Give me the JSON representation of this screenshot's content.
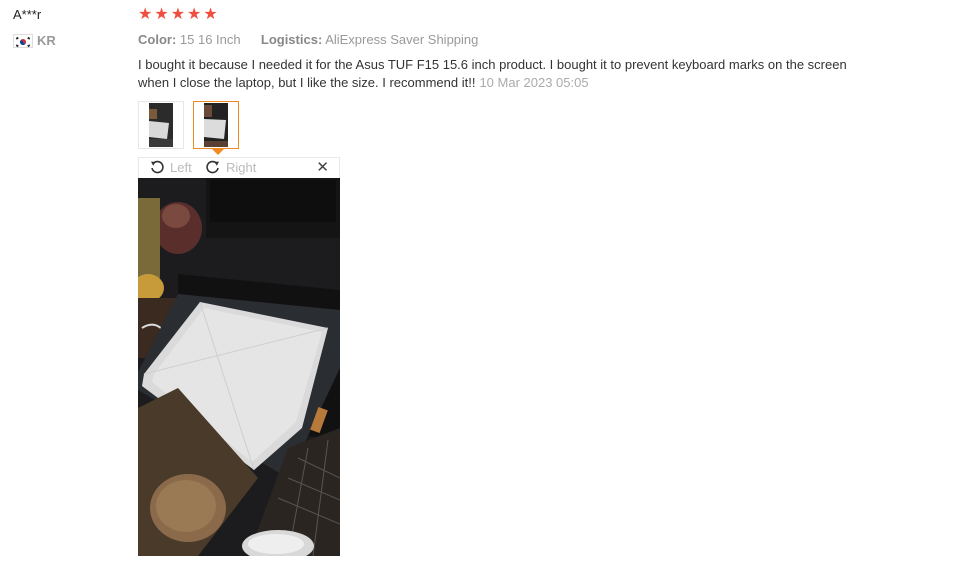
{
  "reviewer": {
    "name": "A***r",
    "country_code": "KR",
    "flag_icon": "korea-flag-icon"
  },
  "rating": {
    "value": 5,
    "max": 5,
    "star_color": "#f04e3e"
  },
  "meta": {
    "color_label": "Color:",
    "color_value": "15 16 Inch",
    "logistics_label": "Logistics:",
    "logistics_value": "AliExpress Saver Shipping"
  },
  "review": {
    "text": "I bought it because I needed it for the Asus TUF F15 15.6 inch product. I bought it to prevent keyboard marks on the screen when I close the laptop, but I like the size. I recommend it!!",
    "date": "10 Mar 2023 05:05"
  },
  "thumbnails": [
    {
      "name": "photo-1",
      "active": false
    },
    {
      "name": "photo-2",
      "active": true
    }
  ],
  "viewer": {
    "rotate_left_label": "Left",
    "rotate_right_label": "Right",
    "rotate_left_icon": "rotate-left-icon",
    "rotate_right_icon": "rotate-right-icon",
    "close_icon": "close-icon",
    "close_glyph": "✕"
  },
  "colors": {
    "accent": "#f08a25",
    "muted": "#999999",
    "text": "#333333"
  }
}
